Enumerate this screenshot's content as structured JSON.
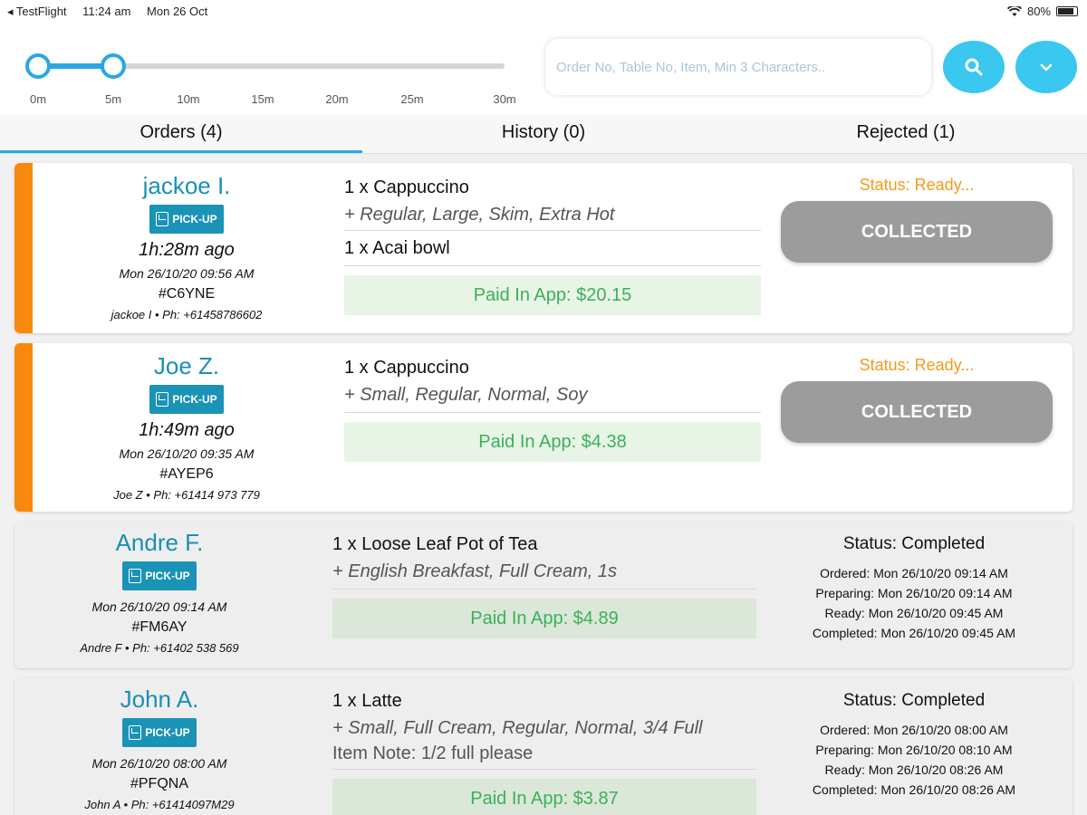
{
  "statusbar": {
    "back_app": "◂ TestFlight",
    "time": "11:24 am",
    "date": "Mon 26 Oct",
    "battery": "80%"
  },
  "slider": {
    "ticks": [
      "0m",
      "5m",
      "10m",
      "15m",
      "20m",
      "25m",
      "30m"
    ],
    "range_start": "0m",
    "range_end": "5m"
  },
  "search": {
    "placeholder": "Order No, Table No, Item, Min 3 Characters.."
  },
  "tabs": [
    {
      "label": "Orders (4)",
      "active": true
    },
    {
      "label": "History (0)",
      "active": false
    },
    {
      "label": "Rejected (1)",
      "active": false
    }
  ],
  "orders": [
    {
      "name": "jackoe I.",
      "pickup": "PICK-UP",
      "ago": "1h:28m ago",
      "datetime": "Mon 26/10/20 09:56 AM",
      "code": "#C6YNE",
      "phone": "jackoe I • Ph: +61458786602",
      "items": [
        {
          "line": "1 x Cappuccino",
          "mods": "+ Regular, Large, Skim, Extra Hot"
        },
        {
          "line": "1 x Acai bowl",
          "mods": ""
        }
      ],
      "paid": "Paid In App: $20.15",
      "status": "Status: Ready...",
      "action": "COLLECTED"
    },
    {
      "name": "Joe Z.",
      "pickup": "PICK-UP",
      "ago": "1h:49m ago",
      "datetime": "Mon 26/10/20 09:35 AM",
      "code": "#AYEP6",
      "phone": "Joe Z • Ph: +61414 973 779",
      "items": [
        {
          "line": "1 x Cappuccino",
          "mods": "+ Small, Regular, Normal, Soy"
        }
      ],
      "paid": "Paid In App: $4.38",
      "status": "Status: Ready...",
      "action": "COLLECTED"
    },
    {
      "name": "Andre F.",
      "pickup": "PICK-UP",
      "datetime": "Mon 26/10/20 09:14 AM",
      "code": "#FM6AY",
      "phone": "Andre F • Ph: +61402 538 569",
      "items": [
        {
          "line": "1 x Loose Leaf Pot of Tea",
          "mods": "+ English Breakfast, Full Cream, 1s"
        }
      ],
      "paid": "Paid In App: $4.89",
      "status": "Status: Completed",
      "timeline": [
        "Ordered: Mon 26/10/20 09:14 AM",
        "Preparing: Mon 26/10/20 09:14 AM",
        "Ready: Mon 26/10/20 09:45 AM",
        "Completed: Mon 26/10/20 09:45 AM"
      ]
    },
    {
      "name": "John A.",
      "pickup": "PICK-UP",
      "datetime": "Mon 26/10/20 08:00 AM",
      "code": "#PFQNA",
      "phone": "John A • Ph: +61414097M29",
      "items": [
        {
          "line": "1 x Latte",
          "mods": "+ Small, Full Cream, Regular, Normal, 3/4 Full",
          "note": "Item Note: 1/2 full please"
        }
      ],
      "paid": "Paid In App: $3.87",
      "status": "Status: Completed",
      "timeline": [
        "Ordered: Mon 26/10/20 08:00 AM",
        "Preparing: Mon 26/10/20 08:10 AM",
        "Ready: Mon 26/10/20 08:26 AM",
        "Completed: Mon 26/10/20 08:26 AM"
      ]
    }
  ],
  "colors": {
    "accent": "#2aa7e3",
    "pickup": "#1b93b6",
    "ready": "#f39a1a",
    "paid": "#3cb05a",
    "stripe": "#f7890f",
    "button_gray": "#9c9c9c"
  },
  "icons": {
    "search": "search-icon",
    "dropdown": "chevron-down-icon",
    "wifi": "wifi-icon",
    "battery": "battery-icon",
    "pickup": "pickup-bag-icon"
  }
}
